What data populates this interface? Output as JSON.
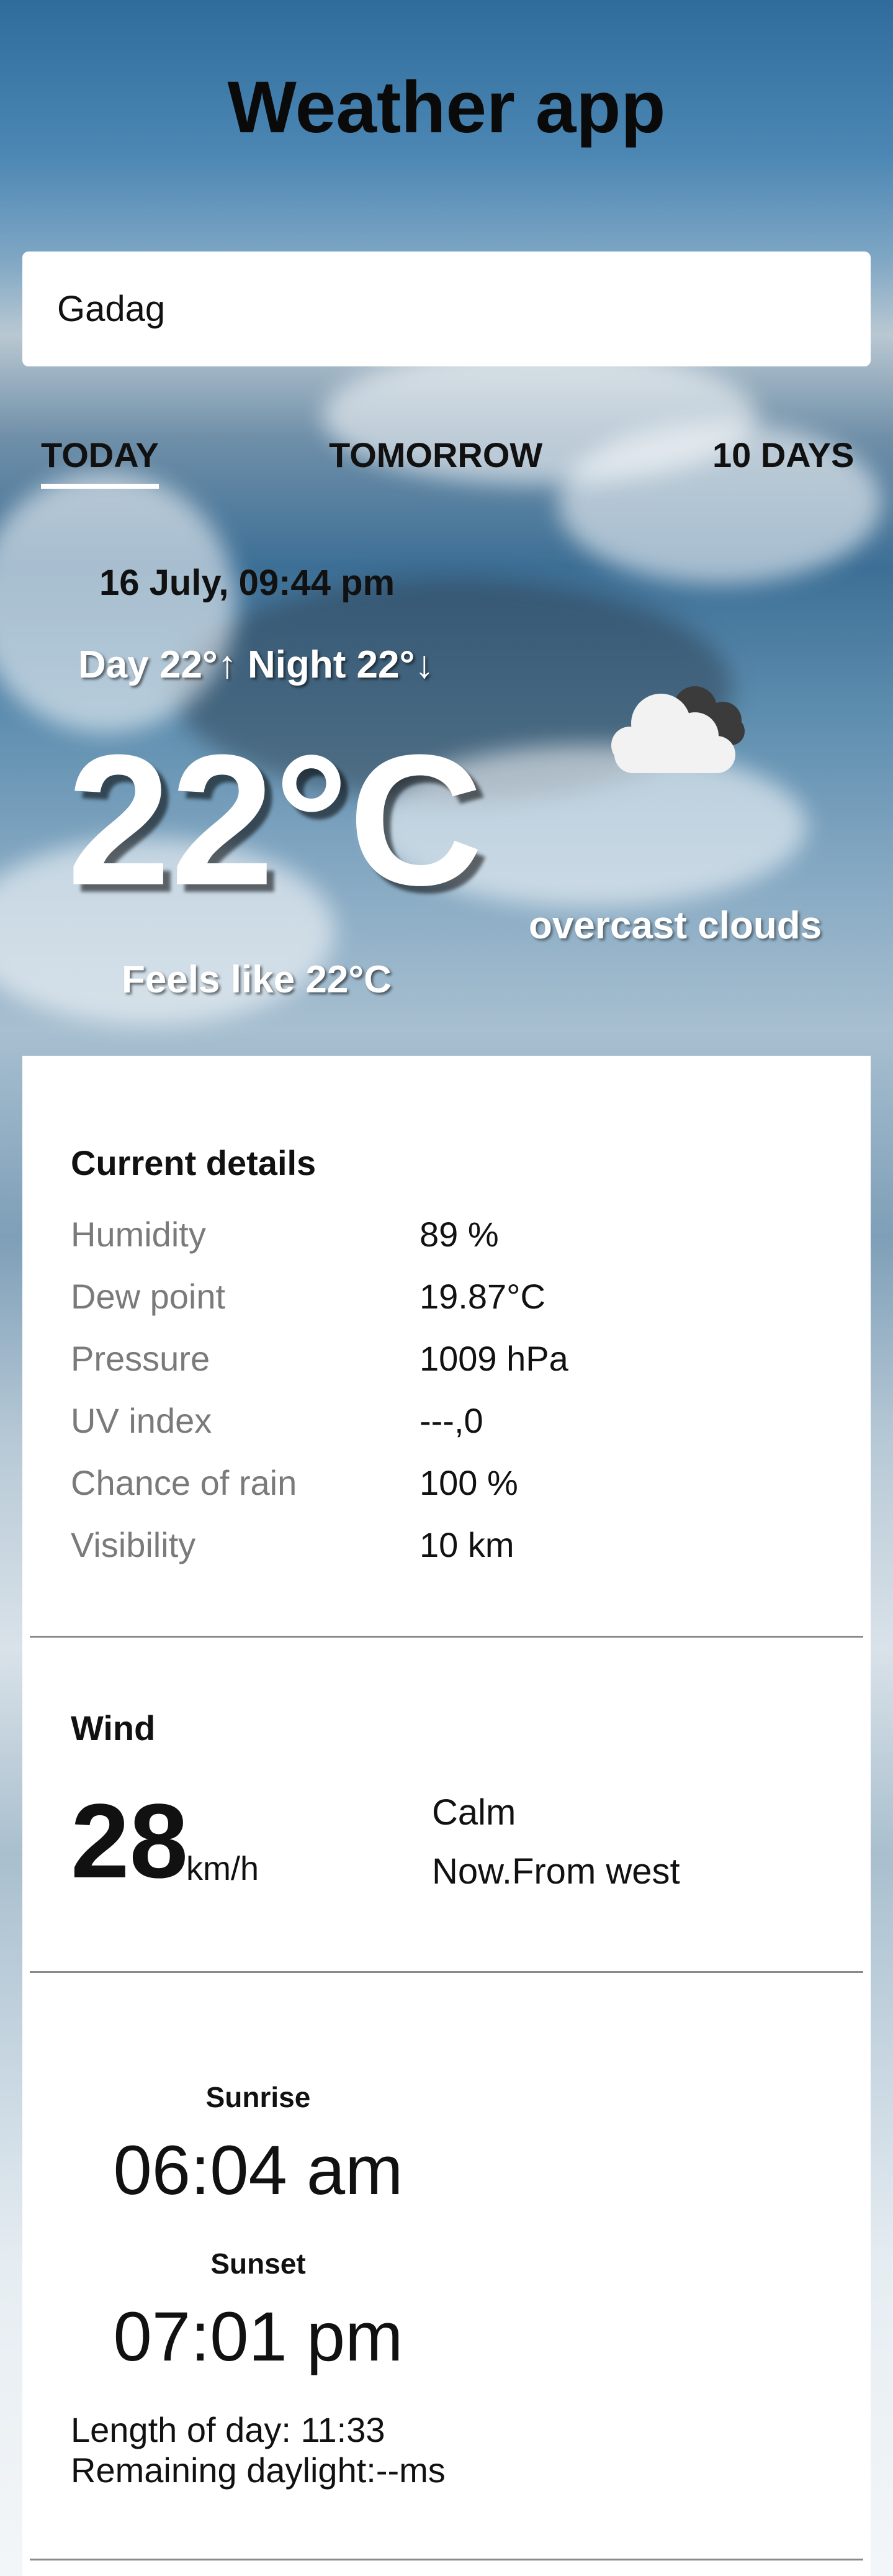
{
  "app": {
    "title": "Weather app"
  },
  "search": {
    "value": "Gadag",
    "placeholder": ""
  },
  "tabs": [
    {
      "label": "TODAY",
      "active": true
    },
    {
      "label": "TOMORROW",
      "active": false
    },
    {
      "label": "10 DAYS",
      "active": false
    }
  ],
  "summary": {
    "date": "16 July, 09:44 pm",
    "day_night": "Day 22°↑ Night 22°↓",
    "temperature": "22°C",
    "condition": "overcast clouds",
    "feels_like": "Feels like 22°C",
    "icon": "overcast-clouds-icon"
  },
  "current_details": {
    "title": "Current details",
    "rows": [
      {
        "label": "Humidity",
        "value": "89 %"
      },
      {
        "label": "Dew point",
        "value": "19.87°C"
      },
      {
        "label": "Pressure",
        "value": "1009 hPa"
      },
      {
        "label": "UV index",
        "value": "---,0"
      },
      {
        "label": "Chance of rain",
        "value": "100 %"
      },
      {
        "label": "Visibility",
        "value": "10 km"
      }
    ]
  },
  "wind": {
    "title": "Wind",
    "speed": "28",
    "unit": "km/h",
    "description": "Calm",
    "direction": "Now.From west"
  },
  "sun": {
    "sunrise_label": "Sunrise",
    "sunrise": "06:04 am",
    "sunset_label": "Sunset",
    "sunset": "07:01 pm",
    "day_length": "Length of day: 11:33",
    "remaining": "Remaining daylight:--ms"
  },
  "colors": {
    "sky": "#4c87b4",
    "panel": "#ffffff",
    "label_gray": "#7a7a7a"
  }
}
